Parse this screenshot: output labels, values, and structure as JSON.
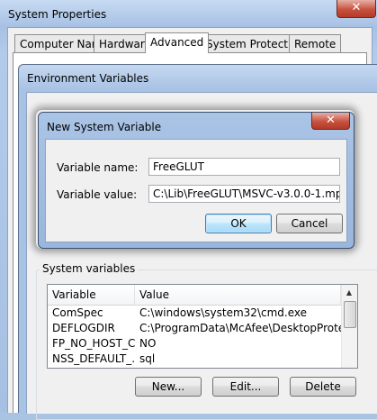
{
  "system_properties": {
    "title": "System Properties",
    "close_glyph": "✕",
    "tabs": [
      {
        "label": "Computer Name",
        "active": false
      },
      {
        "label": "Hardware",
        "active": false
      },
      {
        "label": "Advanced",
        "active": true
      },
      {
        "label": "System Protection",
        "active": false
      },
      {
        "label": "Remote",
        "active": false
      }
    ]
  },
  "env_vars": {
    "title": "Environment Variables",
    "system_variables_label": "System variables",
    "columns": [
      "Variable",
      "Value"
    ],
    "rows": [
      {
        "variable": "ComSpec",
        "value": "C:\\windows\\system32\\cmd.exe"
      },
      {
        "variable": "DEFLOGDIR",
        "value": "C:\\ProgramData\\McAfee\\DesktopProtec..."
      },
      {
        "variable": "FP_NO_HOST_C...",
        "value": "NO"
      },
      {
        "variable": "NSS_DEFAULT_...",
        "value": "sql"
      }
    ],
    "buttons": {
      "new": "New...",
      "edit": "Edit...",
      "delete": "Delete"
    }
  },
  "new_system_variable": {
    "title": "New System Variable",
    "close_glyph": "✕",
    "name_label": "Variable name:",
    "name_value": "FreeGLUT",
    "value_label": "Variable value:",
    "value_value": "C:\\Lib\\FreeGLUT\\MSVC-v3.0.0-1.mp",
    "ok_label": "OK",
    "cancel_label": "Cancel"
  }
}
